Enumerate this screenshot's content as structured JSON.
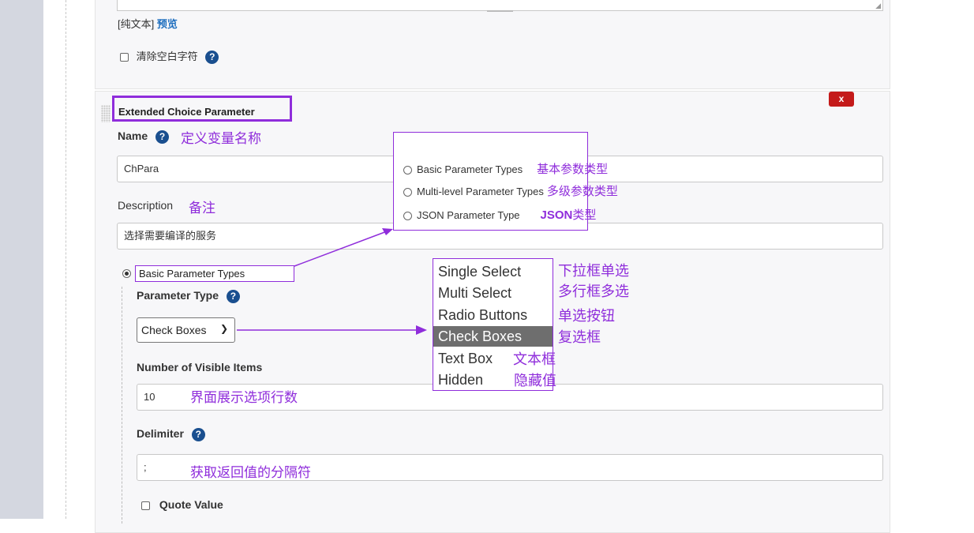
{
  "top_block": {
    "plain_text_label": "[纯文本]",
    "preview_link": "预览",
    "trim_label": "清除空白字符"
  },
  "extended": {
    "title": "Extended Choice Parameter",
    "delete_label": "x",
    "name_label": "Name",
    "name_annotation": "定义变量名称",
    "name_value": "ChPara",
    "description_label": "Description",
    "description_annotation": "备注",
    "description_value": "选择需要编译的服务",
    "basic_radio_label": "Basic Parameter Types",
    "param_type_label": "Parameter Type",
    "param_type_selected": "Check Boxes",
    "visible_items_label": "Number of Visible Items",
    "visible_items_value": "10",
    "visible_items_annotation": "界面展示选项行数",
    "delimiter_label": "Delimiter",
    "delimiter_value": ";",
    "delimiter_annotation": "获取返回值的分隔符",
    "quote_label": "Quote Value"
  },
  "param_types_popover": {
    "items": [
      {
        "label": "Basic Parameter Types",
        "annotation": "基本参数类型"
      },
      {
        "label": "Multi-level Parameter Types",
        "annotation": "多级参数类型"
      },
      {
        "label": "JSON Parameter Type",
        "annotation": "类型",
        "annotation_bold": "JSON"
      }
    ]
  },
  "type_dropdown": {
    "items": [
      {
        "label": "Single Select",
        "annotation": "下拉框单选"
      },
      {
        "label": "Multi Select",
        "annotation": "多行框多选"
      },
      {
        "label": "Radio Buttons",
        "annotation": "单选按钮"
      },
      {
        "label": "Check Boxes",
        "annotation": "复选框",
        "selected": true
      },
      {
        "label": "Text Box",
        "annotation": "文本框"
      },
      {
        "label": "Hidden",
        "annotation": "隐藏值"
      }
    ]
  },
  "colors": {
    "annotation": "#8f2ddb",
    "help_icon": "#1a4f8f",
    "delete_button": "#c41a1a",
    "selected_item": "#6e6e6e"
  }
}
